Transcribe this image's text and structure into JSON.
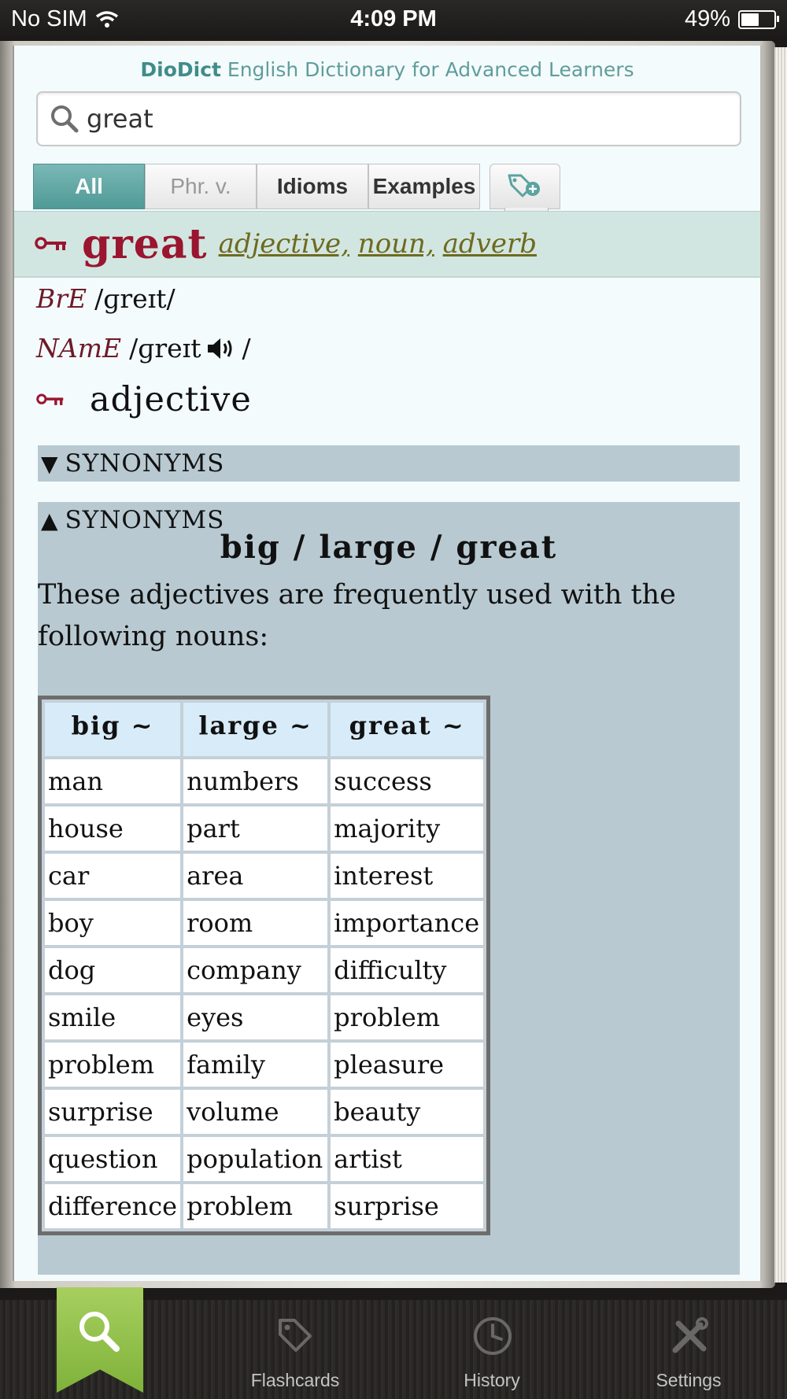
{
  "status_bar": {
    "carrier": "No SIM",
    "time": "4:09 PM",
    "battery": "49%",
    "battery_level": 0.49
  },
  "app": {
    "brand": "DioDict",
    "title_rest": " English Dictionary for Advanced Learners"
  },
  "search": {
    "value": "great",
    "placeholder": ""
  },
  "tabs": [
    "All",
    "Phr. v.",
    "Idioms",
    "Examples"
  ],
  "entry": {
    "headword": "great",
    "pos": [
      "adjective,",
      "noun,",
      "adverb"
    ],
    "pron": [
      {
        "label": "BrE",
        "ipa": "/ɡreɪt/"
      },
      {
        "label": "NAmE",
        "ipa_before": "/ɡreɪt",
        "ipa_after": "/"
      }
    ],
    "section_pos": "adjective",
    "synonyms_collapsed": {
      "arrow": "▼",
      "label": "SYNONYMS"
    },
    "synonyms_expanded": {
      "arrow": "▲",
      "label": "SYNONYMS",
      "subtitle": "big / large / great",
      "description": "These adjectives are frequently used with the following nouns:",
      "columns": [
        "big ~",
        "large ~",
        "great ~"
      ],
      "rows": [
        [
          "man",
          "numbers",
          "success"
        ],
        [
          "house",
          "part",
          "majority"
        ],
        [
          "car",
          "area",
          "interest"
        ],
        [
          "boy",
          "room",
          "importance"
        ],
        [
          "dog",
          "company",
          "difficulty"
        ],
        [
          "smile",
          "eyes",
          "problem"
        ],
        [
          "problem",
          "family",
          "pleasure"
        ],
        [
          "surprise",
          "volume",
          "beauty"
        ],
        [
          "question",
          "population",
          "artist"
        ],
        [
          "difference",
          "problem",
          "surprise"
        ]
      ]
    }
  },
  "bottom_nav": [
    "Flashcards",
    "History",
    "Settings"
  ],
  "colors": {
    "accent": "#4f9a97",
    "headword": "#9a1530",
    "synonym_bg": "#b8c9d1",
    "nav_active": "#8fc04a"
  }
}
